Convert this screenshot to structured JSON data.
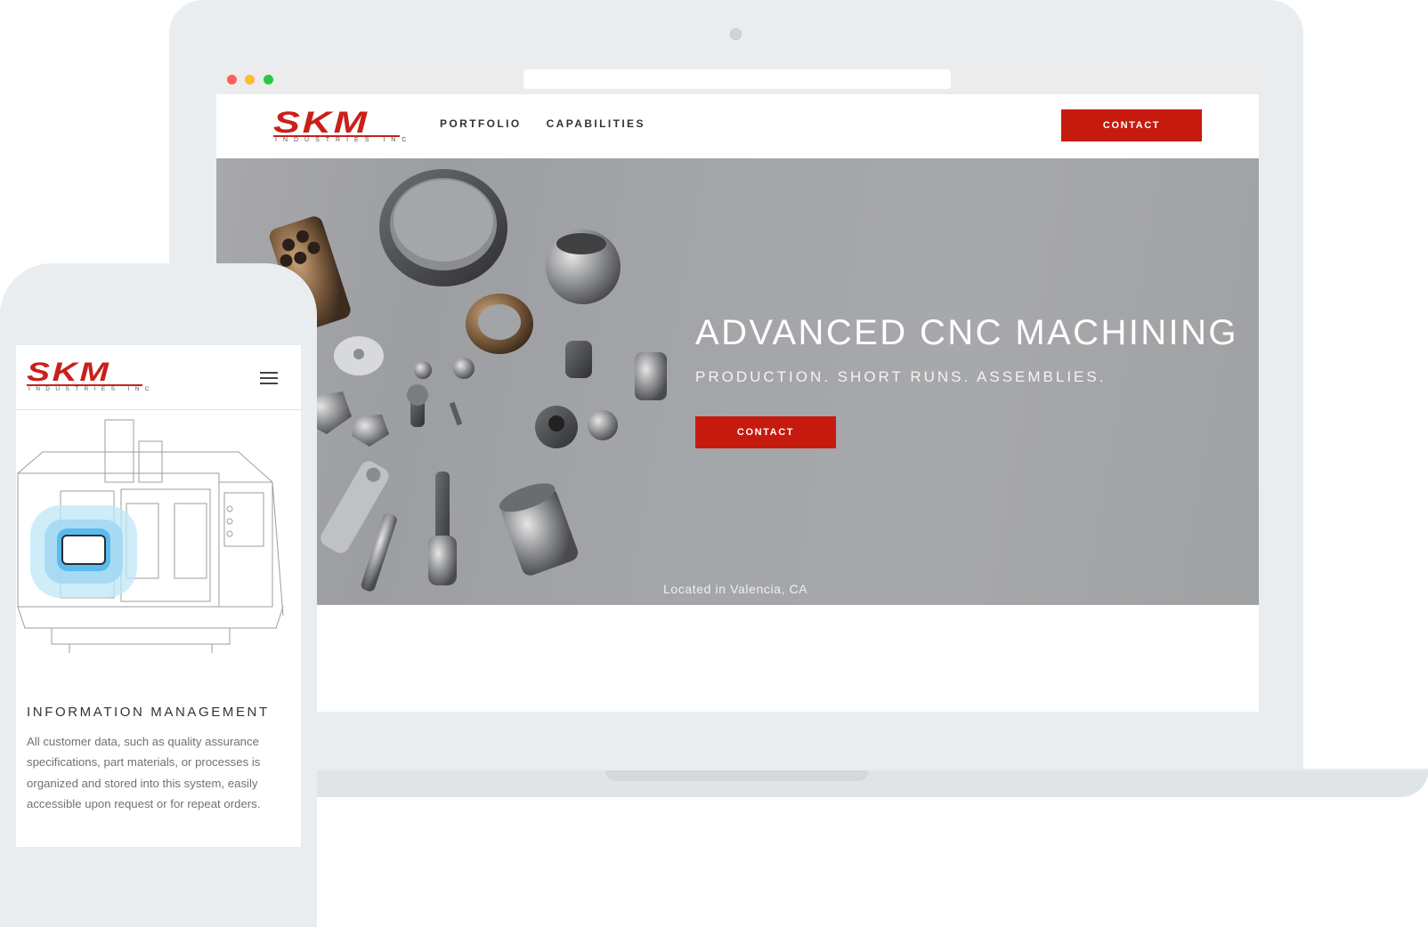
{
  "brand": {
    "logo_main": "SKM",
    "logo_sub": "INDUSTRIES INC",
    "accent_color": "#c71a0e"
  },
  "desktop": {
    "nav": {
      "links": [
        "PORTFOLIO",
        "CAPABILITIES"
      ],
      "contact_label": "CONTACT"
    },
    "hero": {
      "title": "ADVANCED CNC MACHINING",
      "subtitle": "PRODUCTION. SHORT RUNS. ASSEMBLIES.",
      "contact_label": "CONTACT",
      "location": "Located in Valencia, CA"
    }
  },
  "mobile": {
    "menu_icon": "hamburger-icon",
    "section": {
      "heading": "INFORMATION MANAGEMENT",
      "body": "All customer data, such as quality assurance specifications, part materials, or processes is organized and stored into this system, easily accessible upon request or for repeat orders."
    }
  }
}
